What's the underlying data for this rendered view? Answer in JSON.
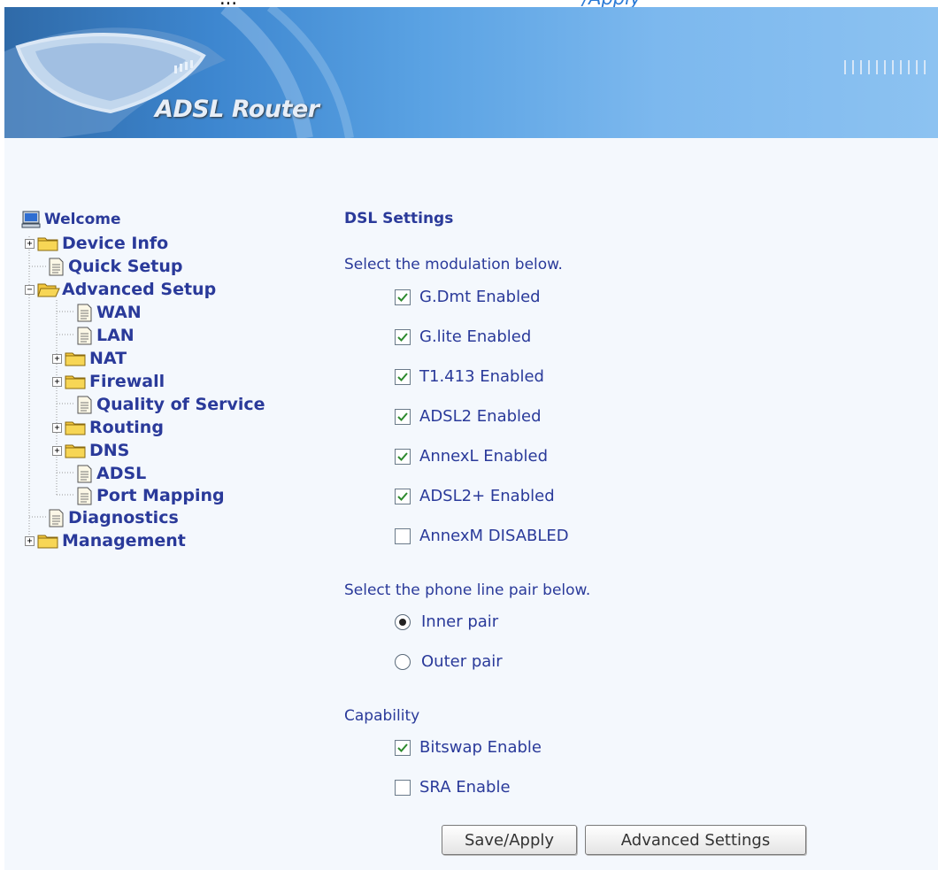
{
  "caption": {
    "left_text": "...",
    "right_text": "/Apply"
  },
  "banner": {
    "title": "ADSL Router"
  },
  "tree": {
    "welcome": "Welcome",
    "device_info": "Device Info",
    "quick_setup": "Quick Setup",
    "advanced_setup": "Advanced Setup",
    "wan": "WAN",
    "lan": "LAN",
    "nat": "NAT",
    "firewall": "Firewall",
    "qos": "Quality of Service",
    "routing": "Routing",
    "dns": "DNS",
    "adsl": "ADSL",
    "port_mapping": "Port Mapping",
    "diagnostics": "Diagnostics",
    "management": "Management"
  },
  "main": {
    "title": "DSL Settings",
    "modulation_prompt": "Select the modulation below.",
    "modulations": [
      {
        "label": "G.Dmt Enabled",
        "checked": true
      },
      {
        "label": "G.lite Enabled",
        "checked": true
      },
      {
        "label": "T1.413 Enabled",
        "checked": true
      },
      {
        "label": "ADSL2 Enabled",
        "checked": true
      },
      {
        "label": "AnnexL Enabled",
        "checked": true
      },
      {
        "label": "ADSL2+ Enabled",
        "checked": true
      },
      {
        "label": "AnnexM DISABLED",
        "checked": false
      }
    ],
    "pair_prompt": "Select the phone line pair below.",
    "pairs": [
      {
        "label": "Inner pair",
        "selected": true
      },
      {
        "label": "Outer pair",
        "selected": false
      }
    ],
    "capability_prompt": "Capability",
    "capabilities": [
      {
        "label": "Bitswap Enable",
        "checked": true
      },
      {
        "label": "SRA Enable",
        "checked": false
      }
    ],
    "save_label": "Save/Apply",
    "advanced_label": "Advanced Settings"
  },
  "colors": {
    "link": "#2a3a9a",
    "banner_start": "#2f6aa8",
    "banner_end": "#8cc2f1",
    "folder": "#f2c63c"
  }
}
